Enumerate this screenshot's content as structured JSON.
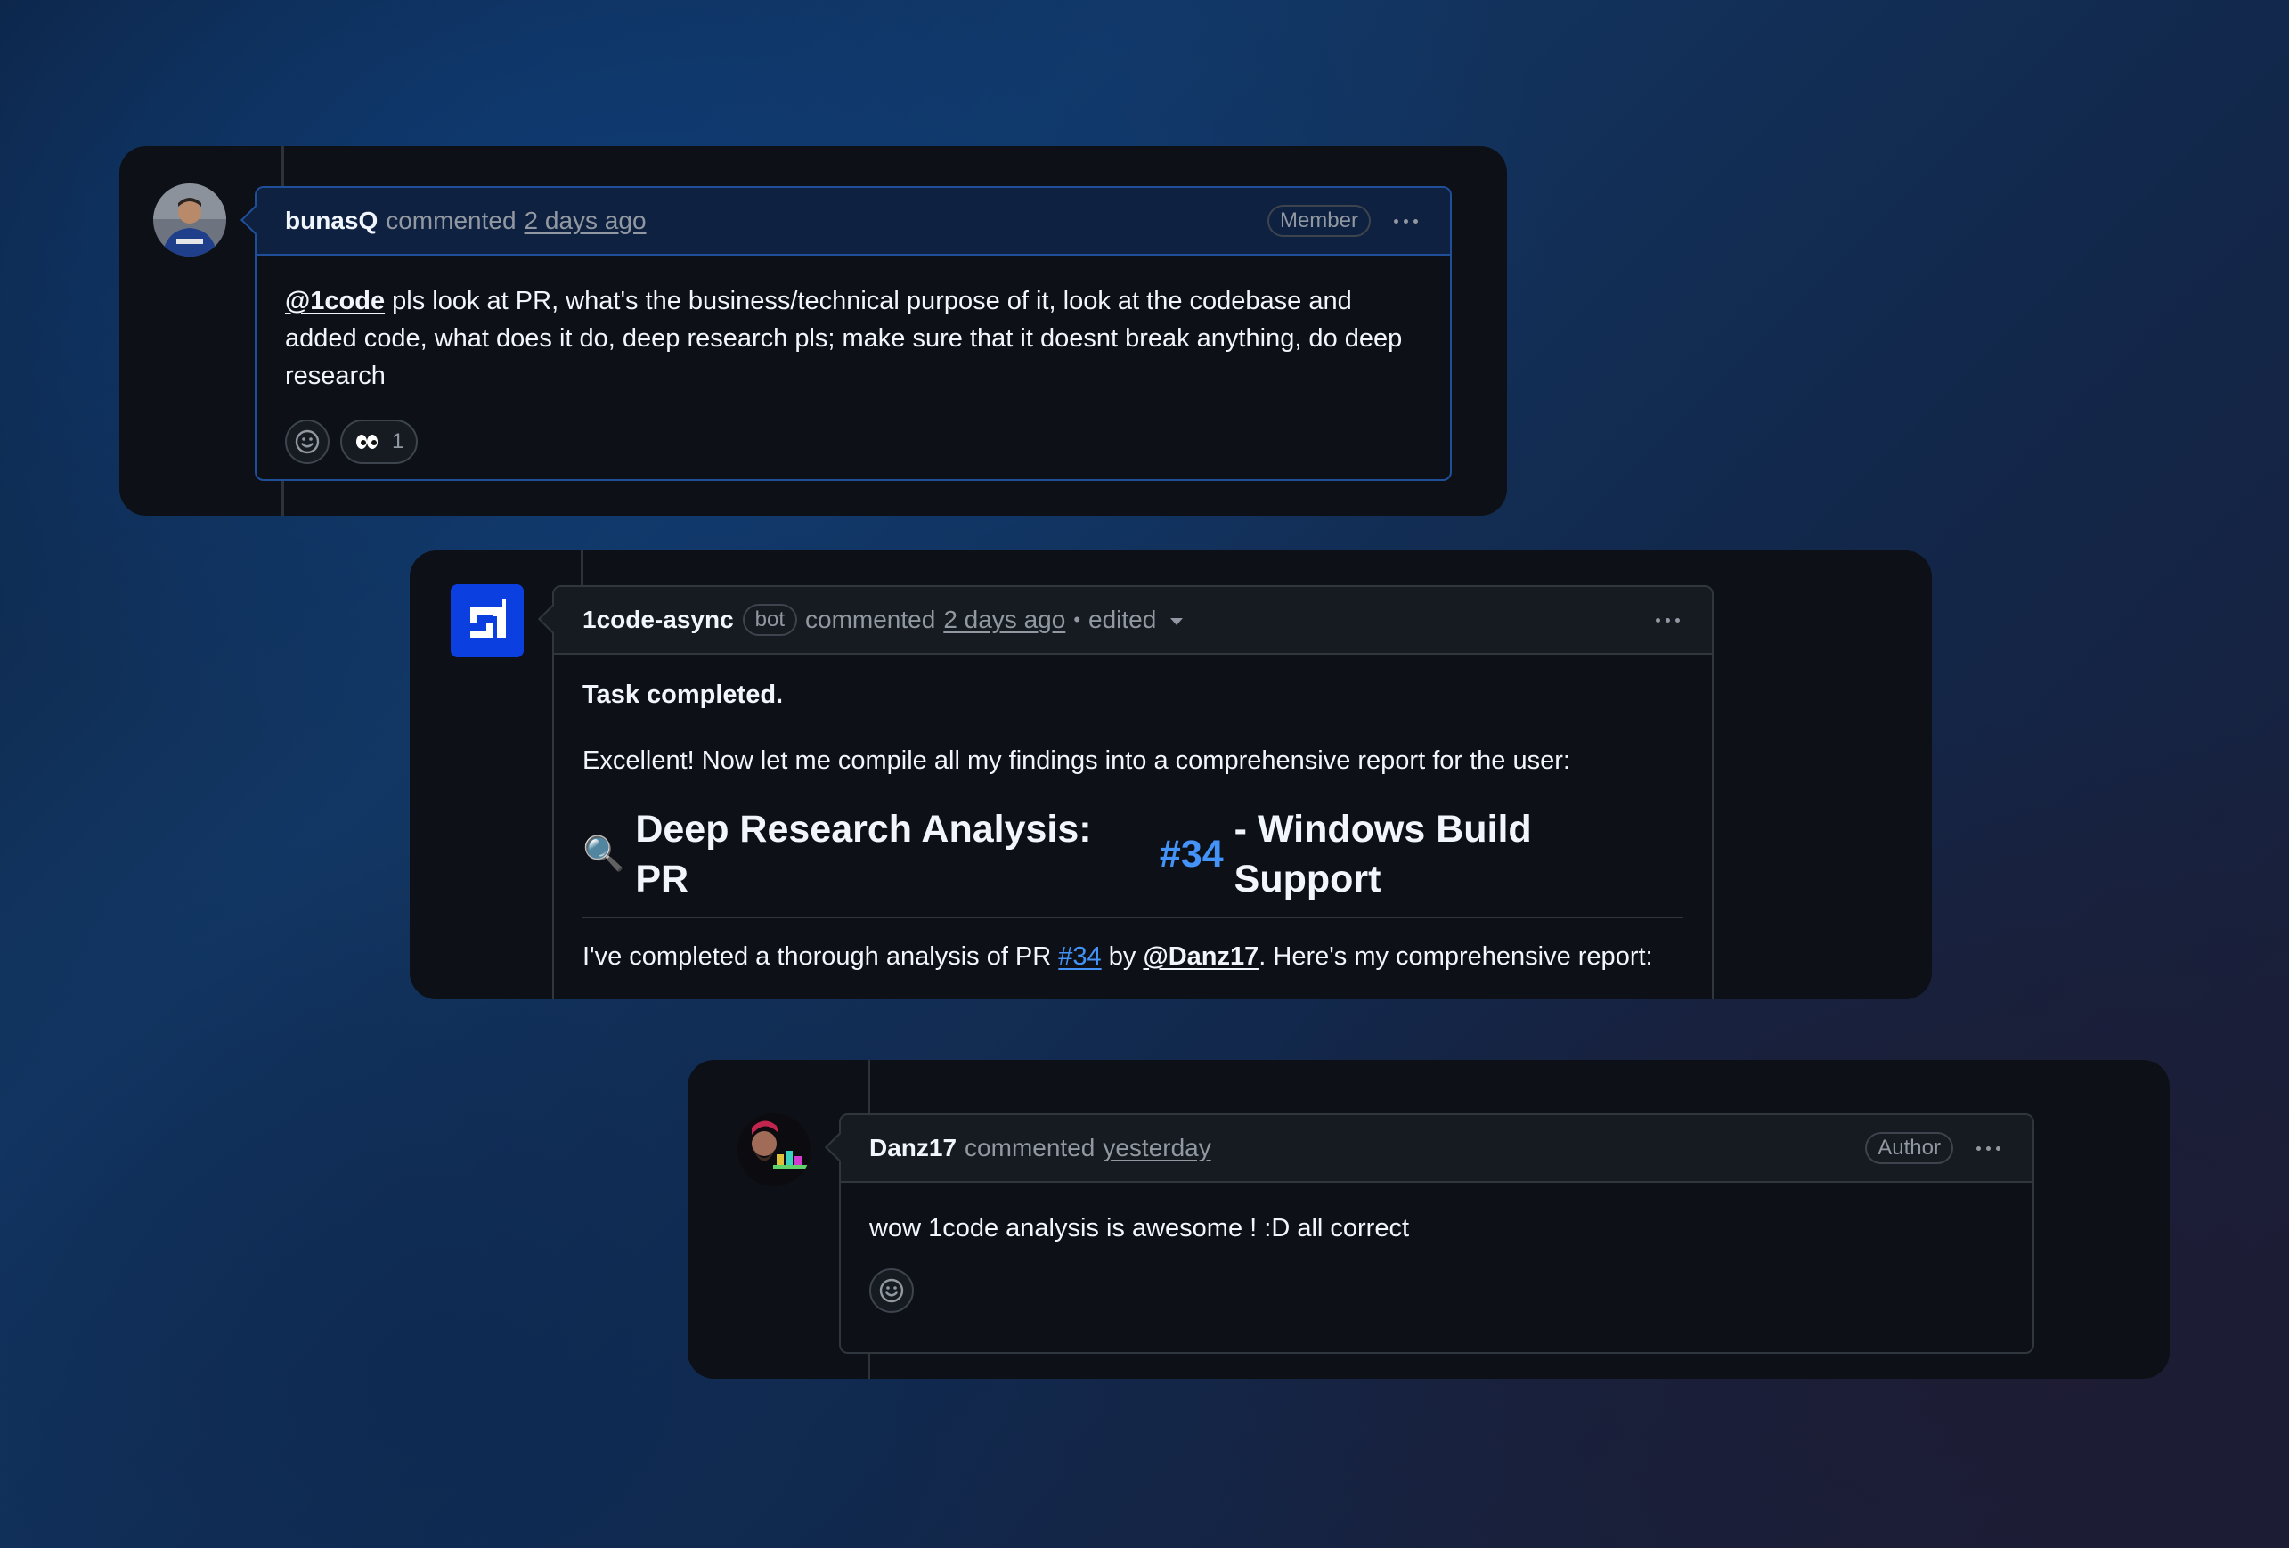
{
  "comments": [
    {
      "author": "bunasQ",
      "action": "commented",
      "time": "2 days ago",
      "badge": "Member",
      "mention": "@1code",
      "body_text": "pls look at PR, what's the business/technical purpose of it, look at the codebase and added code, what does it do, deep research pls; make sure that it doesnt break anything, do deep research",
      "reaction": {
        "icon": "eyes-emoji",
        "emoji": "👀",
        "count": "1"
      }
    },
    {
      "author": "1code-async",
      "bot_label": "bot",
      "action": "commented",
      "time": "2 days ago",
      "separator": "•",
      "edited": "edited",
      "task_status": "Task completed.",
      "intro": "Excellent! Now let me compile all my findings into a comprehensive report for the user:",
      "heading_emoji": "🔍",
      "heading_prefix": "Deep Research Analysis: PR",
      "heading_link": "#34",
      "heading_suffix": "- Windows Build Support",
      "summary_prefix": "I've completed a thorough analysis of PR",
      "summary_link": "#34",
      "summary_by": "by",
      "summary_mention": "@Danz17",
      "summary_suffix": ". Here's my comprehensive report:"
    },
    {
      "author": "Danz17",
      "action": "commented",
      "time": "yesterday",
      "badge": "Author",
      "body_text": "wow 1code analysis is awesome ! :D all correct"
    }
  ],
  "colors": {
    "accent_link": "#4493f8",
    "bot_avatar": "#0b3fe0",
    "panel_bg": "#0d1117"
  }
}
